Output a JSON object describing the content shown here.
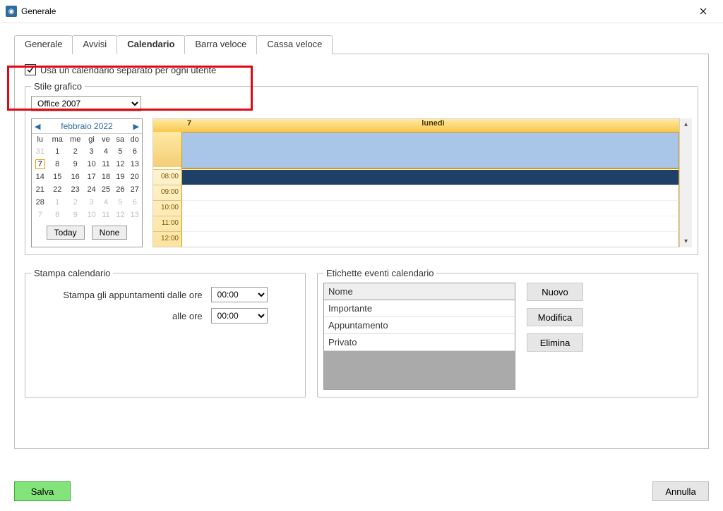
{
  "window": {
    "title": "Generale"
  },
  "tabs": [
    "Generale",
    "Avvisi",
    "Calendario",
    "Barra veloce",
    "Cassa veloce"
  ],
  "active_tab": 2,
  "checkbox": {
    "label": "Usa un calendario separato per ogni utente",
    "checked": true
  },
  "style_group": {
    "legend": "Stile grafico",
    "selected": "Office 2007"
  },
  "monthcal": {
    "title": "febbraio 2022",
    "daynames": [
      "lu",
      "ma",
      "me",
      "gi",
      "ve",
      "sa",
      "do"
    ],
    "rows": [
      [
        {
          "d": "31",
          "dim": true
        },
        {
          "d": "1"
        },
        {
          "d": "2"
        },
        {
          "d": "3"
        },
        {
          "d": "4"
        },
        {
          "d": "5"
        },
        {
          "d": "6"
        }
      ],
      [
        {
          "d": "7",
          "sel": true
        },
        {
          "d": "8"
        },
        {
          "d": "9"
        },
        {
          "d": "10"
        },
        {
          "d": "11"
        },
        {
          "d": "12"
        },
        {
          "d": "13"
        }
      ],
      [
        {
          "d": "14"
        },
        {
          "d": "15"
        },
        {
          "d": "16"
        },
        {
          "d": "17"
        },
        {
          "d": "18"
        },
        {
          "d": "19"
        },
        {
          "d": "20"
        }
      ],
      [
        {
          "d": "21"
        },
        {
          "d": "22"
        },
        {
          "d": "23"
        },
        {
          "d": "24"
        },
        {
          "d": "25"
        },
        {
          "d": "26"
        },
        {
          "d": "27"
        }
      ],
      [
        {
          "d": "28"
        },
        {
          "d": "1",
          "dim": true
        },
        {
          "d": "2",
          "dim": true
        },
        {
          "d": "3",
          "dim": true
        },
        {
          "d": "4",
          "dim": true
        },
        {
          "d": "5",
          "dim": true
        },
        {
          "d": "6",
          "dim": true
        }
      ],
      [
        {
          "d": "7",
          "dim": true
        },
        {
          "d": "8",
          "dim": true
        },
        {
          "d": "9",
          "dim": true
        },
        {
          "d": "10",
          "dim": true
        },
        {
          "d": "11",
          "dim": true
        },
        {
          "d": "12",
          "dim": true
        },
        {
          "d": "13",
          "dim": true
        }
      ]
    ],
    "today": "Today",
    "none": "None"
  },
  "dayview": {
    "daynum": "7",
    "dayname": "lunedì",
    "times": [
      "08:00",
      "09:00",
      "10:00",
      "11:00",
      "12:00"
    ],
    "selected_slot": 0
  },
  "print_group": {
    "legend": "Stampa calendario",
    "from_label": "Stampa gli appuntamenti dalle ore",
    "to_label": "alle ore",
    "from_value": "00:00",
    "to_value": "00:00"
  },
  "labels_group": {
    "legend": "Etichette eventi calendario",
    "header": "Nome",
    "items": [
      "Importante",
      "Appuntamento",
      "Privato"
    ],
    "btn_new": "Nuovo",
    "btn_edit": "Modifica",
    "btn_del": "Elimina"
  },
  "footer": {
    "save": "Salva",
    "cancel": "Annulla"
  }
}
